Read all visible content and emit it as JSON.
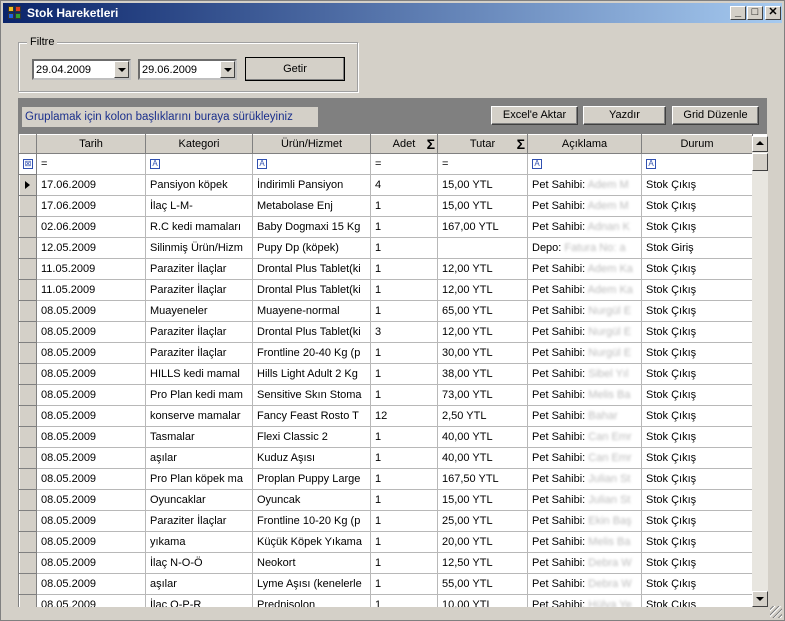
{
  "window": {
    "title": "Stok Hareketleri",
    "controls": {
      "minimize": "_",
      "maximize": "□",
      "close": "✕"
    }
  },
  "filter": {
    "legend": "Filtre",
    "start_date": "29.04.2009",
    "end_date": "29.06.2009",
    "apply_label": "Getir"
  },
  "group_panel": {
    "hint": "Gruplamak için kolon başlıklarını buraya sürükleyiniz",
    "excel_label": "Excel'e Aktar",
    "print_label": "Yazdır",
    "grid_edit_label": "Grid Düzenle"
  },
  "grid": {
    "columns": [
      "Tarih",
      "Kategori",
      "Ürün/Hizmet",
      "Adet",
      "Tutar",
      "Açıklama",
      "Durum"
    ],
    "filter_ops": [
      "=",
      "A",
      "A",
      "=",
      "=",
      "A",
      "A"
    ],
    "rows": [
      [
        "17.06.2009",
        "Pansiyon köpek",
        "İndirimli Pansiyon",
        "4",
        "15,00 YTL",
        "Pet Sahibi:",
        "Adem M",
        "Stok Çıkış"
      ],
      [
        "17.06.2009",
        "İlaç L-M-",
        "Metabolase Enj",
        "1",
        "15,00 YTL",
        "Pet Sahibi:",
        "Adem M",
        "Stok Çıkış"
      ],
      [
        "02.06.2009",
        "R.C kedi mamaları",
        "Baby Dogmaxi 15 Kg",
        "1",
        "167,00 YTL",
        "Pet Sahibi:",
        "Adnan K",
        "Stok Çıkış"
      ],
      [
        "12.05.2009",
        "Silinmiş Ürün/Hizm",
        "Pupy Dp (köpek)",
        "1",
        "",
        "Depo:",
        "Fatura No: a",
        "Stok Giriş"
      ],
      [
        "11.05.2009",
        "Paraziter İlaçlar",
        "Drontal Plus Tablet(ki",
        "1",
        "12,00 YTL",
        "Pet Sahibi:",
        "Adem Ka",
        "Stok Çıkış"
      ],
      [
        "11.05.2009",
        "Paraziter İlaçlar",
        "Drontal Plus Tablet(ki",
        "1",
        "12,00 YTL",
        "Pet Sahibi:",
        "Adem Ka",
        "Stok Çıkış"
      ],
      [
        "08.05.2009",
        "Muayeneler",
        "Muayene-normal",
        "1",
        "65,00 YTL",
        "Pet Sahibi:",
        "Nurgül E",
        "Stok Çıkış"
      ],
      [
        "08.05.2009",
        "Paraziter İlaçlar",
        "Drontal Plus Tablet(ki",
        "3",
        "12,00 YTL",
        "Pet Sahibi:",
        "Nurgül E",
        "Stok Çıkış"
      ],
      [
        "08.05.2009",
        "Paraziter İlaçlar",
        "Frontline 20-40 Kg (p",
        "1",
        "30,00 YTL",
        "Pet Sahibi:",
        "Nurgül E",
        "Stok Çıkış"
      ],
      [
        "08.05.2009",
        "HILLS kedi mamal",
        "Hills Light Adult 2 Kg",
        "1",
        "38,00 YTL",
        "Pet Sahibi:",
        "Sibel Yıl",
        "Stok Çıkış"
      ],
      [
        "08.05.2009",
        "Pro Plan kedi mam",
        "Sensitive Skın Stoma",
        "1",
        "73,00 YTL",
        "Pet Sahibi:",
        "Melis Ba",
        "Stok Çıkış"
      ],
      [
        "08.05.2009",
        "konserve mamalar",
        "Fancy Feast Rosto T",
        "12",
        "2,50 YTL",
        "Pet Sahibi:",
        "Bahar",
        "Stok Çıkış"
      ],
      [
        "08.05.2009",
        "Tasmalar",
        "Flexi Classic 2",
        "1",
        "40,00 YTL",
        "Pet Sahibi:",
        "Can Emr",
        "Stok Çıkış"
      ],
      [
        "08.05.2009",
        "aşılar",
        "Kuduz Aşısı",
        "1",
        "40,00 YTL",
        "Pet Sahibi:",
        "Can Emr",
        "Stok Çıkış"
      ],
      [
        "08.05.2009",
        "Pro Plan köpek ma",
        "Proplan Puppy Large",
        "1",
        "167,50 YTL",
        "Pet Sahibi:",
        "Julian St",
        "Stok Çıkış"
      ],
      [
        "08.05.2009",
        "Oyuncaklar",
        "Oyuncak",
        "1",
        "15,00 YTL",
        "Pet Sahibi:",
        "Julian St",
        "Stok Çıkış"
      ],
      [
        "08.05.2009",
        "Paraziter İlaçlar",
        "Frontline 10-20 Kg (p",
        "1",
        "25,00 YTL",
        "Pet Sahibi:",
        "Ekin Baş",
        "Stok Çıkış"
      ],
      [
        "08.05.2009",
        "yıkama",
        "Küçük Köpek Yıkama",
        "1",
        "20,00 YTL",
        "Pet Sahibi:",
        "Melis Ba",
        "Stok Çıkış"
      ],
      [
        "08.05.2009",
        "İlaç N-O-Ö",
        "Neokort",
        "1",
        "12,50 YTL",
        "Pet Sahibi:",
        "Debra W",
        "Stok Çıkış"
      ],
      [
        "08.05.2009",
        "aşılar",
        "Lyme Aşısı (kenelerle",
        "1",
        "55,00 YTL",
        "Pet Sahibi:",
        "Debra W",
        "Stok Çıkış"
      ],
      [
        "08.05.2009",
        "İlaç O-P-R",
        "Prednisolon",
        "1",
        "10,00 YTL",
        "Pet Sahibi:",
        "Hülya Ye",
        "Stok Çıkış"
      ]
    ]
  }
}
